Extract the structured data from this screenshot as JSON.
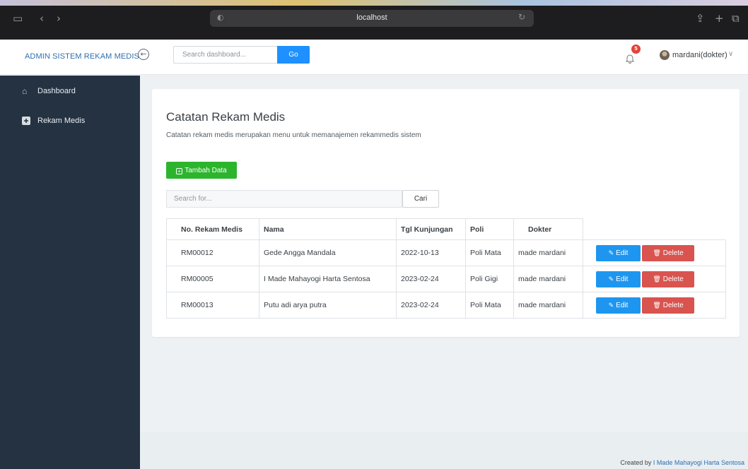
{
  "browser": {
    "url": "localhost",
    "icons": [
      "sidebar-icon",
      "back-icon",
      "forward-icon",
      "shield-icon",
      "reload-icon",
      "share-icon",
      "new-tab-icon",
      "tabs-icon"
    ]
  },
  "header": {
    "brand": "ADMIN SISTEM REKAM MEDIS",
    "search_placeholder": "Search dashboard...",
    "go_label": "Go",
    "notification_count": "5",
    "user_name": "mardani(dokter)"
  },
  "sidebar": {
    "items": [
      {
        "label": "Dashboard",
        "icon": "home-icon"
      },
      {
        "label": "Rekam Medis",
        "icon": "plus-square-icon"
      }
    ]
  },
  "main": {
    "title": "Catatan Rekam Medis",
    "description": "Catatan rekam medis merupakan menu untuk memanajemen rekammedis sistem",
    "add_label": "Tambah Data",
    "search_placeholder": "Search for...",
    "search_button": "Cari",
    "table": {
      "columns": [
        "No. Rekam Medis",
        "Nama",
        "Tgl Kunjungan",
        "Poli",
        "Dokter"
      ],
      "rows": [
        {
          "no": "RM00012",
          "nama": "Gede Angga Mandala",
          "tgl": "2022-10-13",
          "poli": "Poli Mata",
          "dokter": "made mardani"
        },
        {
          "no": "RM00005",
          "nama": "I Made Mahayogi Harta Sentosa",
          "tgl": "2023-02-24",
          "poli": "Poli Gigi",
          "dokter": "made mardani"
        },
        {
          "no": "RM00013",
          "nama": "Putu adi arya putra",
          "tgl": "2023-02-24",
          "poli": "Poli Mata",
          "dokter": "made mardani"
        }
      ],
      "edit_label": "Edit",
      "delete_label": "Delete"
    }
  },
  "footer": {
    "prefix": "Created by ",
    "author": "I Made Mahayogi Harta Sentosa"
  },
  "colors": {
    "sidebar_bg": "#243242",
    "primary": "#1e90ff",
    "success": "#2cb52c",
    "danger": "#d9534f",
    "brand": "#2f6fb0"
  }
}
